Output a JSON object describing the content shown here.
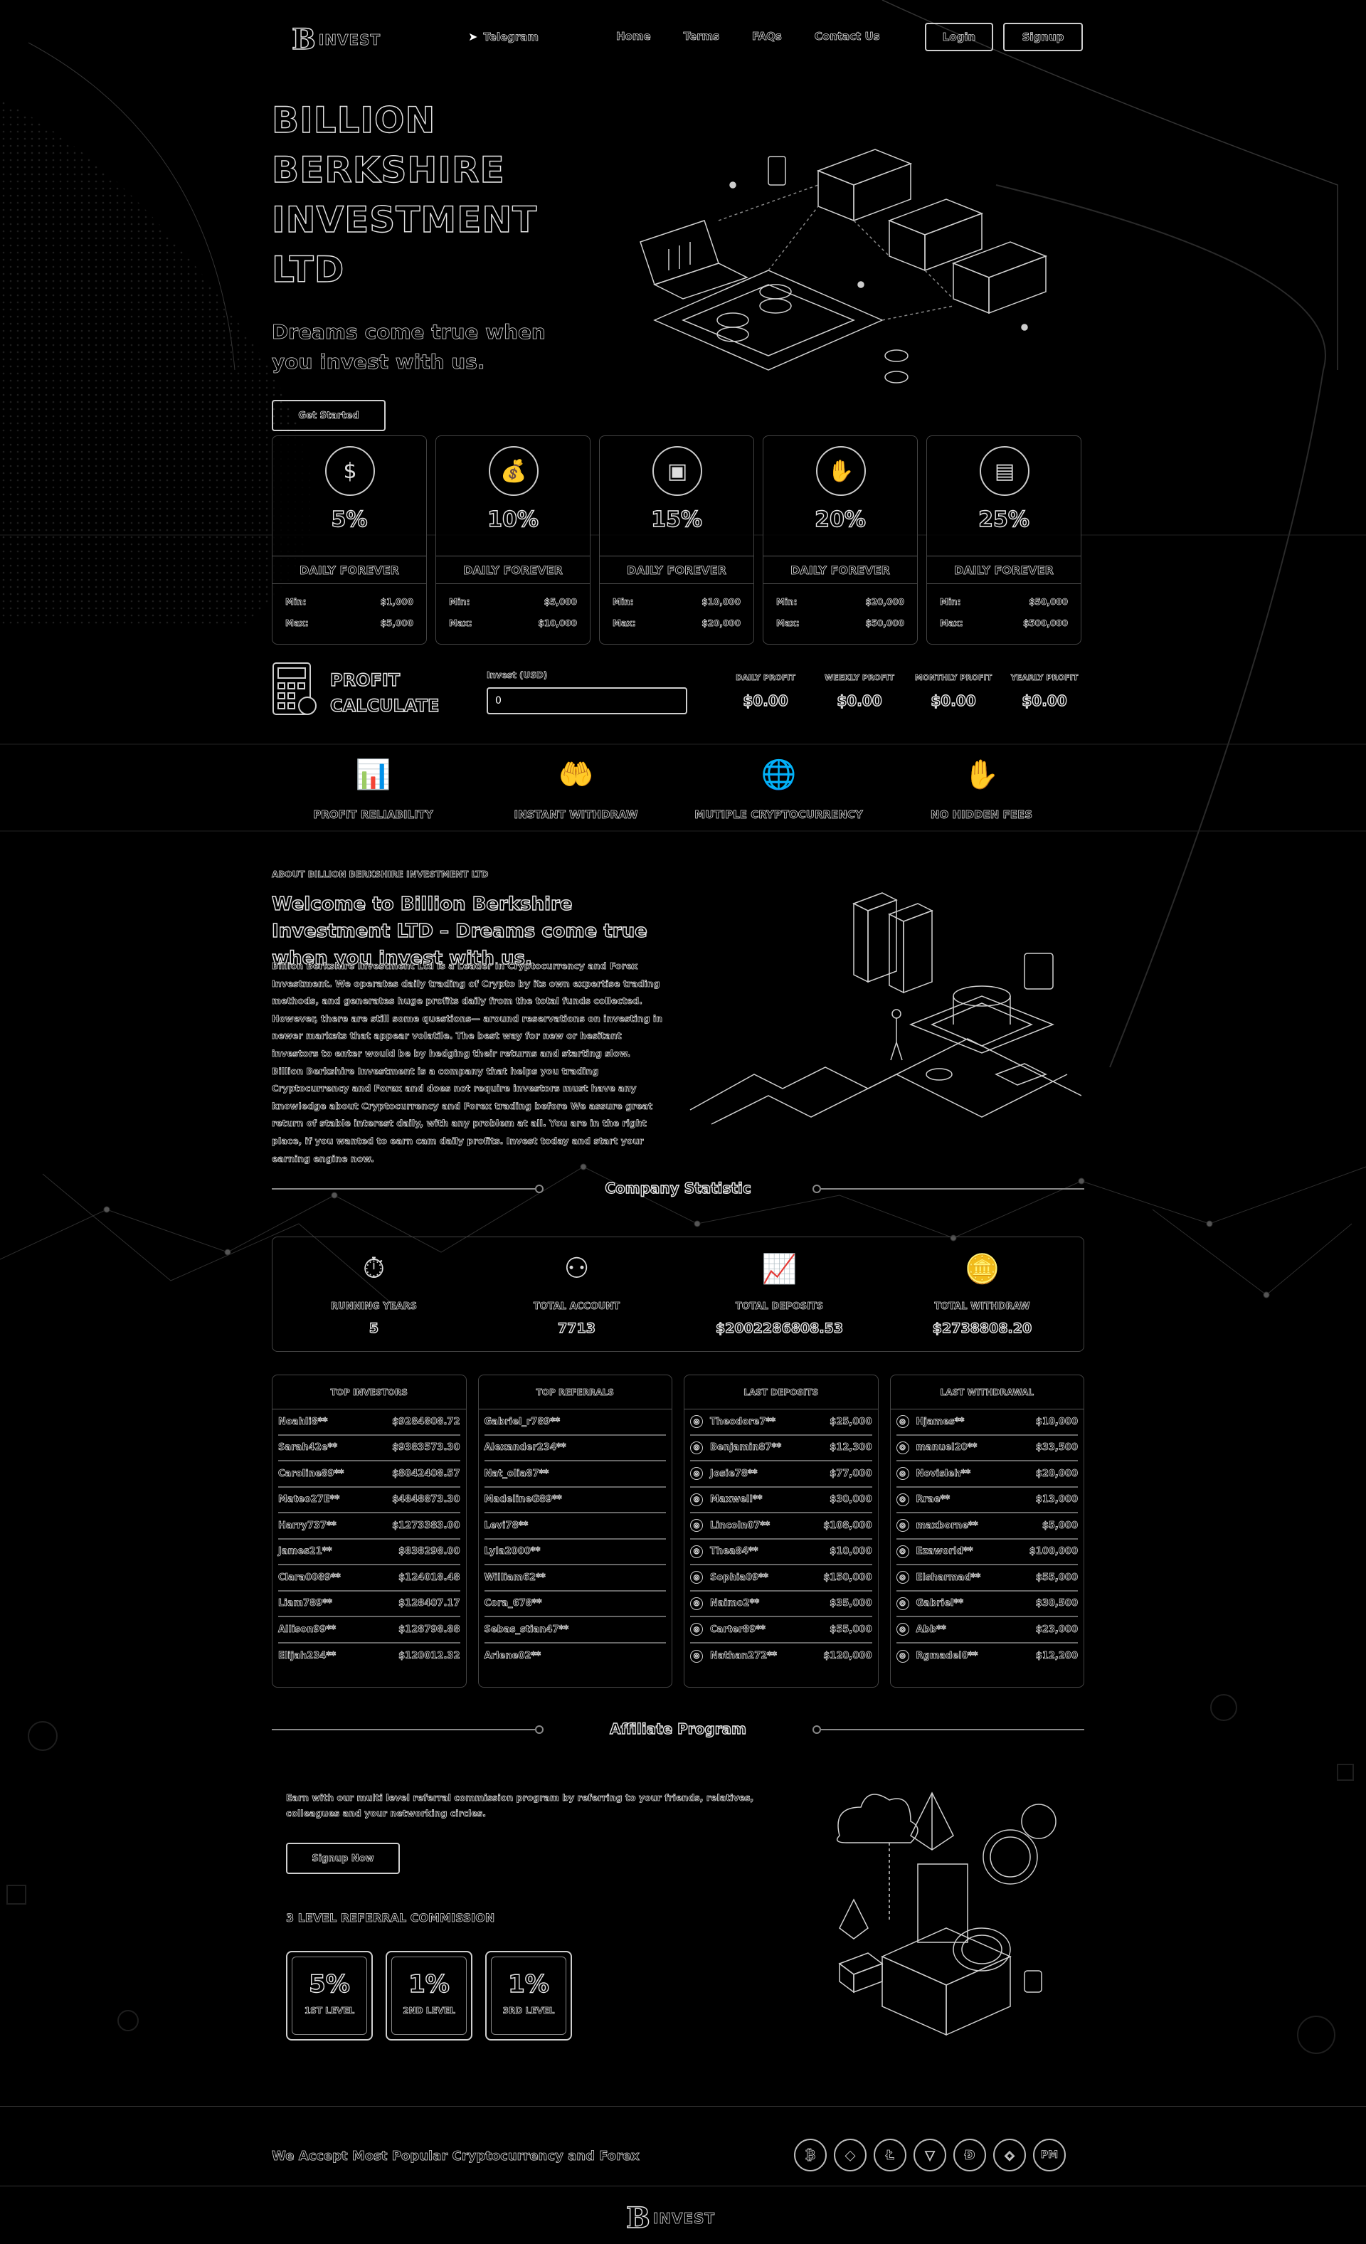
{
  "brand": {
    "mark": "B",
    "name": "INVEST"
  },
  "nav": {
    "telegram": "Telegram",
    "links": [
      "Home",
      "Terms",
      "FAQs",
      "Contact Us"
    ],
    "login": "Login",
    "signup": "Signup"
  },
  "hero": {
    "title_lines": [
      "BILLION",
      "BERKSHIRE",
      "INVESTMENT",
      "LTD"
    ],
    "subtitle": "Dreams come true when you invest with us.",
    "cta": "Get Started"
  },
  "plans": [
    {
      "pct": "5%",
      "label": "DAILY FOREVER",
      "min_label": "Min:",
      "min": "$1,000",
      "max_label": "Max:",
      "max": "$5,000",
      "icon": "money-icon"
    },
    {
      "pct": "10%",
      "label": "DAILY FOREVER",
      "min_label": "Min:",
      "min": "$5,000",
      "max_label": "Max:",
      "max": "$10,000",
      "icon": "money-bag-icon"
    },
    {
      "pct": "15%",
      "label": "DAILY FOREVER",
      "min_label": "Min:",
      "min": "$10,000",
      "max_label": "Max:",
      "max": "$20,000",
      "icon": "monitor-icon"
    },
    {
      "pct": "20%",
      "label": "DAILY FOREVER",
      "min_label": "Min:",
      "min": "$20,000",
      "max_label": "Max:",
      "max": "$50,000",
      "icon": "money-hands-icon"
    },
    {
      "pct": "25%",
      "label": "DAILY FOREVER",
      "min_label": "Min:",
      "min": "$50,000",
      "max_label": "Max:",
      "max": "$500,000",
      "icon": "money-stack-icon"
    }
  ],
  "calc": {
    "title_line1": "PROFIT",
    "title_line2": "CALCULATE",
    "input_label": "Invest (USD)",
    "input_value": "0",
    "results": [
      {
        "label": "DAILY PROFIT",
        "value": "$0.00"
      },
      {
        "label": "WEEKLY PROFIT",
        "value": "$0.00"
      },
      {
        "label": "MONTHLY PROFIT",
        "value": "$0.00"
      },
      {
        "label": "YEARLY PROFIT",
        "value": "$0.00"
      }
    ]
  },
  "features": [
    {
      "label": "PROFIT RELIABILITY",
      "icon": "chart-coin-icon"
    },
    {
      "label": "INSTANT WITHDRAW",
      "icon": "hand-money-icon"
    },
    {
      "label": "MUTIPLE CRYPTOCURRENCY",
      "icon": "globe-coin-icon"
    },
    {
      "label": "NO HIDDEN FEES",
      "icon": "hand-stop-icon"
    }
  ],
  "about": {
    "kicker": "ABOUT BILLION BERKSHIRE INVESTMENT LTD",
    "title": "Welcome to Billion Berkshire Investment LTD – Dreams come true when you invest with us.",
    "text": "Billion Berkshire Investment Ltd is a Leader in Cryptocurrency and Forex Investment. We operates daily trading of Crypto by its own expertise trading methods, and generates huge profits daily from the total funds collected. However, there are still some questions— around reservations on investing in newer markets that appear volatile. The best way for new or hesitant investors to enter would be by hedging their returns and starting slow. Billion Berkshire Investment is a company that helps you trading Cryptocurrency and Forex and does not require investors must have any knowledge about Cryptocurrency and Forex trading before We assure great return of stable interest daily, with any problem at all. You are in the right place, if you wanted to earn cam daily profits. Invest today and start your earning engine now."
  },
  "stats": {
    "heading": "Company Statistic",
    "items": [
      {
        "label": "RUNNING YEARS",
        "value": "5",
        "icon": "stopwatch-icon"
      },
      {
        "label": "TOTAL ACCOUNT",
        "value": "7713",
        "icon": "network-icon"
      },
      {
        "label": "TOTAL DEPOSITS",
        "value": "$2002286808.53",
        "icon": "growth-chart-icon"
      },
      {
        "label": "TOTAL WITHDRAW",
        "value": "$2738808.20",
        "icon": "coins-icon"
      }
    ]
  },
  "tables": {
    "top_investors": {
      "title": "TOP INVESTORS",
      "rows": [
        [
          "Noahli8**",
          "$9284808.72"
        ],
        [
          "Sarah42e**",
          "$9383573.30"
        ],
        [
          "Caroline89**",
          "$8042408.57"
        ],
        [
          "Mateo27E**",
          "$4848873.30"
        ],
        [
          "Harry737**",
          "$1273383.00"
        ],
        [
          "James21**",
          "$838298.00"
        ],
        [
          "Clara0089**",
          "$124018.48"
        ],
        [
          "Liam789**",
          "$128407.17"
        ],
        [
          "Allison99**",
          "$128798.88"
        ],
        [
          "Elijah234**",
          "$120012.32"
        ]
      ]
    },
    "top_referrals": {
      "title": "TOP REFERRALS",
      "rows": [
        "Gabriel_r789**",
        "Alexander234**",
        "Nat_olia87**",
        "MadelineG89**",
        "Levi78**",
        "Lyla2000**",
        "William62**",
        "Cora_678**",
        "Sebas_stian47**",
        "Arlene02**"
      ]
    },
    "last_deposits": {
      "title": "LAST DEPOSITS",
      "rows": [
        [
          "Theodore7**",
          "$25,000"
        ],
        [
          "Benjamin87**",
          "$12,300"
        ],
        [
          "Josie78**",
          "$77,000"
        ],
        [
          "Maxwell**",
          "$30,000"
        ],
        [
          "Lincoln07**",
          "$108,000"
        ],
        [
          "Thea84**",
          "$10,000"
        ],
        [
          "Sophia09**",
          "$150,000"
        ],
        [
          "Naimo2**",
          "$35,000"
        ],
        [
          "Carter89**",
          "$55,000"
        ],
        [
          "Nathan272**",
          "$120,000"
        ]
      ]
    },
    "last_withdrawal": {
      "title": "LAST WITHDRAWAL",
      "rows": [
        [
          "Hjames**",
          "$10,000"
        ],
        [
          "manuel20**",
          "$33,500"
        ],
        [
          "Novisleh**",
          "$20,000"
        ],
        [
          "Rrae**",
          "$13,000"
        ],
        [
          "maxborne**",
          "$5,000"
        ],
        [
          "Ezaworld**",
          "$100,000"
        ],
        [
          "Elsharmad**",
          "$55,000"
        ],
        [
          "Gabriel**",
          "$30,500"
        ],
        [
          "Abb**",
          "$23,000"
        ],
        [
          "Rgmadel0**",
          "$12,200"
        ]
      ]
    }
  },
  "affiliate": {
    "heading": "Affiliate Program",
    "text": "Earn with our multi level referral commission program by referring to your friends, relatives, colleagues and your networking circles.",
    "cta": "Signup Now",
    "levels_title": "3 LEVEL REFERRAL COMMISSION",
    "levels": [
      {
        "pct": "5%",
        "name": "1ST LEVEL"
      },
      {
        "pct": "1%",
        "name": "2ND LEVEL"
      },
      {
        "pct": "1%",
        "name": "3RD LEVEL"
      }
    ]
  },
  "footer": {
    "accept": "We Accept Most Popular Cryptocurrency and Forex",
    "cryptos": [
      {
        "glyph": "₿",
        "name": "bitcoin-icon"
      },
      {
        "glyph": "◆",
        "name": "ethereum-icon"
      },
      {
        "glyph": "Ł",
        "name": "litecoin-icon"
      },
      {
        "glyph": "▽",
        "name": "tron-icon"
      },
      {
        "glyph": "Đ",
        "name": "dogecoin-icon"
      },
      {
        "glyph": "◈",
        "name": "bnb-icon"
      },
      {
        "glyph": "PM",
        "name": "perfect-money-icon"
      }
    ]
  }
}
